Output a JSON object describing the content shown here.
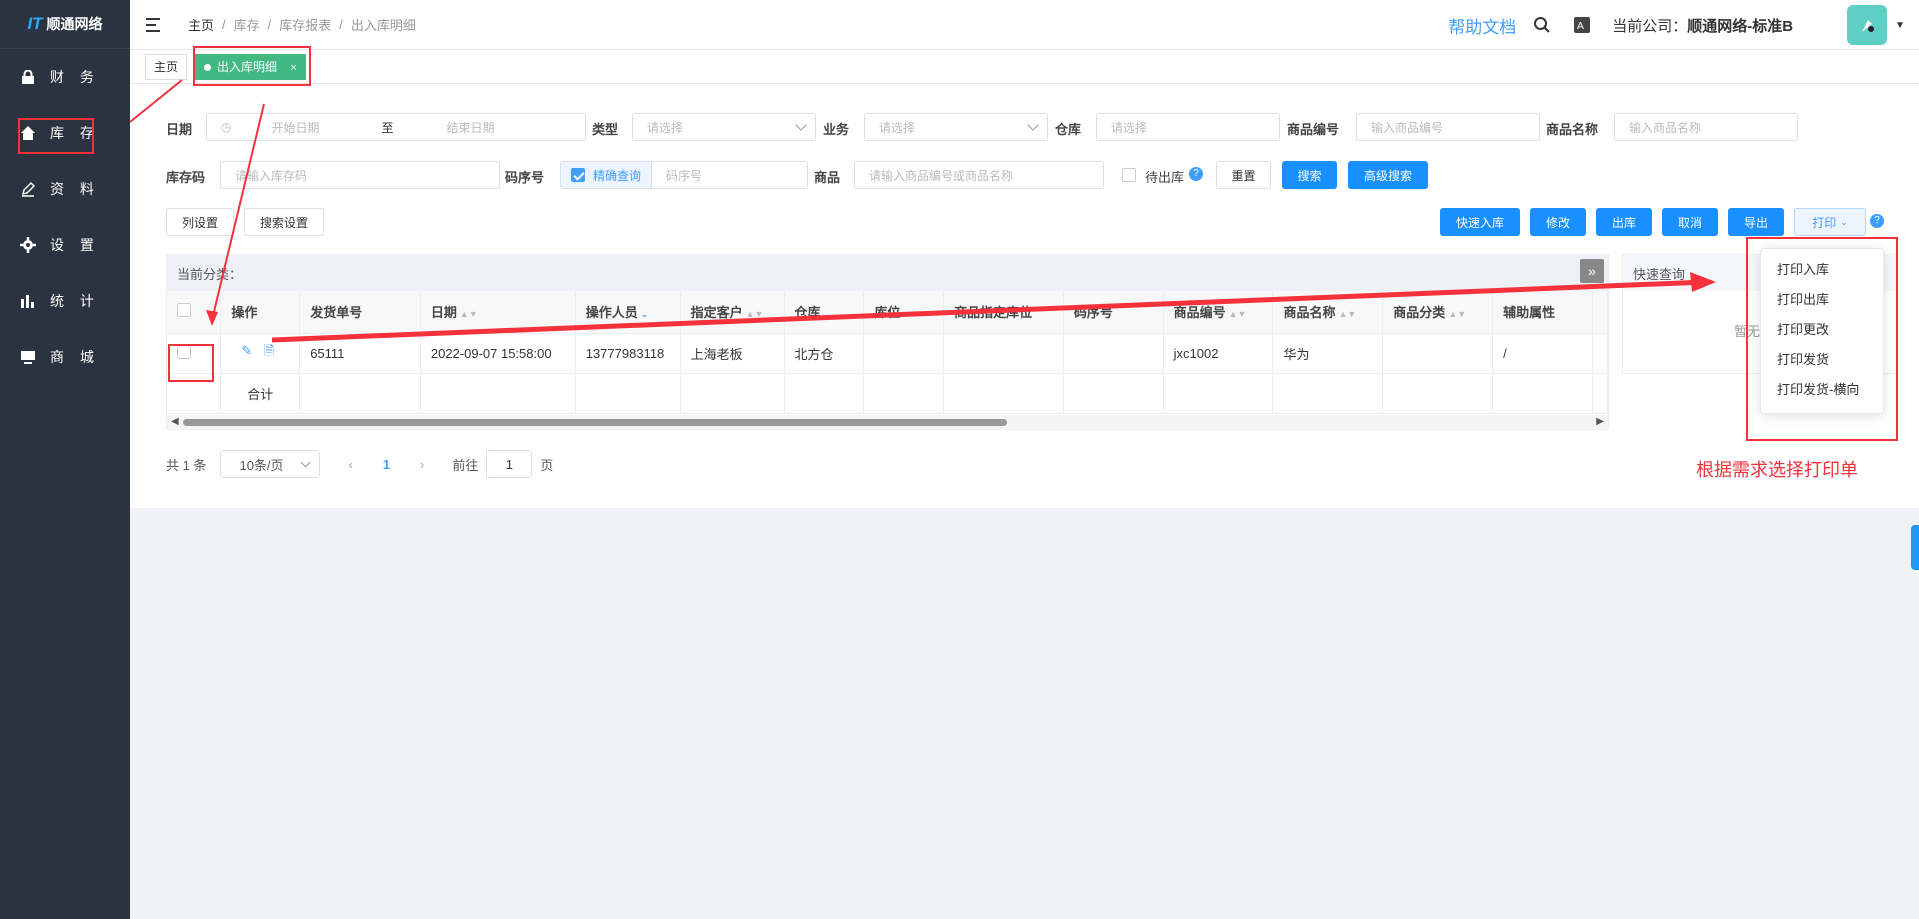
{
  "sidebar": {
    "logo_mark": "IT",
    "logo_text": "顺通网络",
    "items": [
      {
        "label": "财 务",
        "icon": "lock-icon"
      },
      {
        "label": "库 存",
        "icon": "home-icon"
      },
      {
        "label": "资 料",
        "icon": "edit-icon"
      },
      {
        "label": "设 置",
        "icon": "gear-icon"
      },
      {
        "label": "统 计",
        "icon": "bar-chart-icon"
      },
      {
        "label": "商 城",
        "icon": "monitor-icon"
      }
    ]
  },
  "header": {
    "breadcrumb": [
      "主页",
      "库存",
      "库存报表",
      "出入库明细"
    ],
    "help": "帮助文档",
    "company_label": "当前公司：",
    "company_name": "顺通网络-标准B"
  },
  "tabs": [
    {
      "label": "主页"
    },
    {
      "label": "出入库明细",
      "close": "×"
    }
  ],
  "filters": {
    "date_label": "日期",
    "date_start_placeholder": "开始日期",
    "date_sep": "至",
    "date_end_placeholder": "结束日期",
    "type_label": "类型",
    "type_placeholder": "请选择",
    "biz_label": "业务",
    "biz_placeholder": "请选择",
    "warehouse_label": "仓库",
    "warehouse_placeholder": "请选择",
    "code_label": "商品编号",
    "code_placeholder": "输入商品编号",
    "name_label": "商品名称",
    "name_placeholder": "输入商品名称",
    "stock_code_label": "库存码",
    "stock_code_placeholder": "请输入库存码",
    "serial_label": "码序号",
    "exact_label": "精确查询",
    "serial_placeholder": "码序号",
    "goods_label": "商品",
    "goods_placeholder": "请输入商品编号或商品名称",
    "pending_label": "待出库",
    "reset": "重置",
    "search": "搜索",
    "advanced": "高级搜索"
  },
  "toolbar": {
    "col_settings": "列设置",
    "search_settings": "搜索设置",
    "quick_in": "快速入库",
    "edit": "修改",
    "out": "出库",
    "cancel": "取消",
    "export": "导出",
    "print": "打印"
  },
  "table": {
    "category_label": "当前分类：",
    "headers": [
      "",
      "操作",
      "发货单号",
      "日期",
      "操作人员",
      "指定客户",
      "仓库",
      "库位",
      "商品指定库位",
      "码序号",
      "商品编号",
      "商品名称",
      "商品分类",
      "辅助属性",
      ""
    ],
    "row": [
      "",
      "",
      "65111",
      "2022-09-07 15:58:00",
      "13777983118",
      "上海老板",
      "北方仓",
      "",
      "",
      "",
      "jxc1002",
      "华为",
      "",
      "/",
      ""
    ],
    "total_label": "合计"
  },
  "quick_query": {
    "title": "快速查询",
    "empty": "暂无数据"
  },
  "print_menu": [
    "打印入库",
    "打印出库",
    "打印更改",
    "打印发货",
    "打印发货-横向"
  ],
  "pager": {
    "total": "共 1 条",
    "size": "10条/页",
    "current": "1",
    "goto_label": "前往",
    "goto_value": "1",
    "page_suffix": "页"
  },
  "annotation": {
    "note": "根据需求选择打印单"
  },
  "colors": {
    "sidebar": "#2b3340",
    "primary": "#1890ff",
    "tab_active": "#42b983",
    "annotation": "#f5313b"
  }
}
